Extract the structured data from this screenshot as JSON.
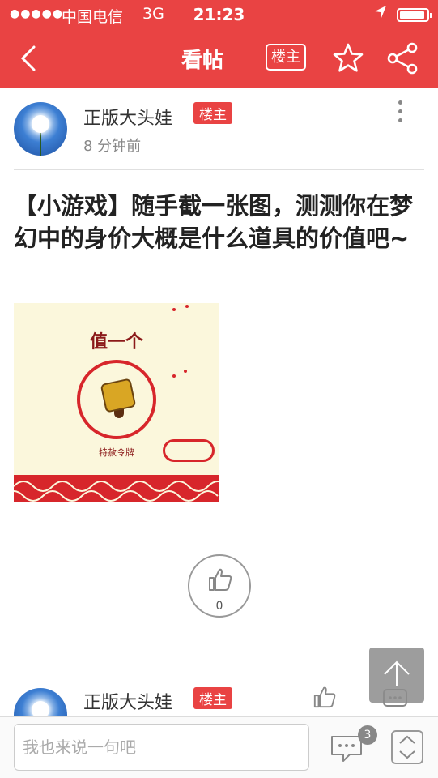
{
  "status_bar": {
    "signal": "●●●●●",
    "carrier": "中国电信",
    "network": "3G",
    "time": "21:23"
  },
  "nav": {
    "title": "看帖",
    "louzhu_button": "楼主",
    "icons": [
      "back-icon",
      "star-icon",
      "share-icon"
    ]
  },
  "post": {
    "author_name": "正版大头娃",
    "author_badge": "楼主",
    "posted_time": "8 分钟前",
    "title": "【小游戏】随手截一张图，测测你在梦幻中的身价大概是什么道具的价值吧~",
    "image": {
      "heading": "值一个",
      "caption": "特赦令牌"
    },
    "like_count": "0"
  },
  "reply": {
    "author_name": "正版大头娃",
    "author_badge": "楼主"
  },
  "bottom_bar": {
    "input_placeholder": "我也来说一句吧",
    "comment_count": "3"
  },
  "colors": {
    "brand_red": "#e94343",
    "badge_red": "#e94343",
    "scroll_top_bg": "#8c8c8c"
  }
}
